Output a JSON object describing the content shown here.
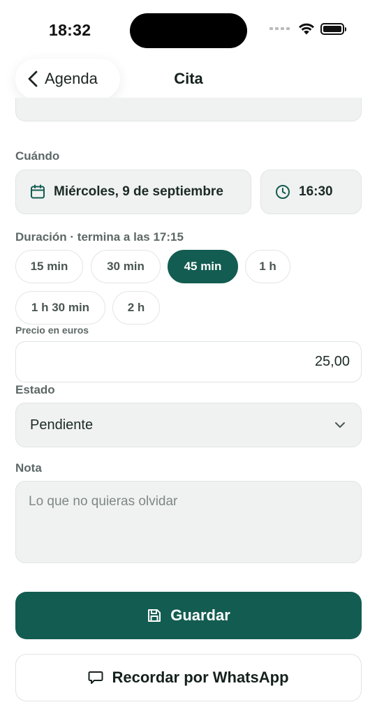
{
  "status_bar": {
    "time": "18:32"
  },
  "nav": {
    "back_label": "Agenda",
    "title": "Cita"
  },
  "when": {
    "label": "Cuándo",
    "date": "Miércoles, 9 de septiembre",
    "time": "16:30"
  },
  "duration": {
    "label": "Duración · termina a las 17:15",
    "options": [
      "15 min",
      "30 min",
      "45 min",
      "1 h",
      "1 h 30 min",
      "2 h"
    ],
    "selected": "45 min"
  },
  "price": {
    "label": "Precio en euros",
    "value": "25,00"
  },
  "status": {
    "label": "Estado",
    "value": "Pendiente"
  },
  "note": {
    "label": "Nota",
    "placeholder": "Lo que no quieras olvidar"
  },
  "actions": {
    "save_label": "Guardar",
    "whatsapp_label": "Recordar por WhatsApp"
  },
  "colors": {
    "accent": "#135c51",
    "field_bg": "#f0f2f1",
    "border": "#dfe4e2"
  },
  "icons": [
    "chevron-left-icon",
    "calendar-icon",
    "clock-icon",
    "chevron-down-icon",
    "save-icon",
    "chat-bubble-icon",
    "wifi-icon",
    "battery-icon"
  ]
}
